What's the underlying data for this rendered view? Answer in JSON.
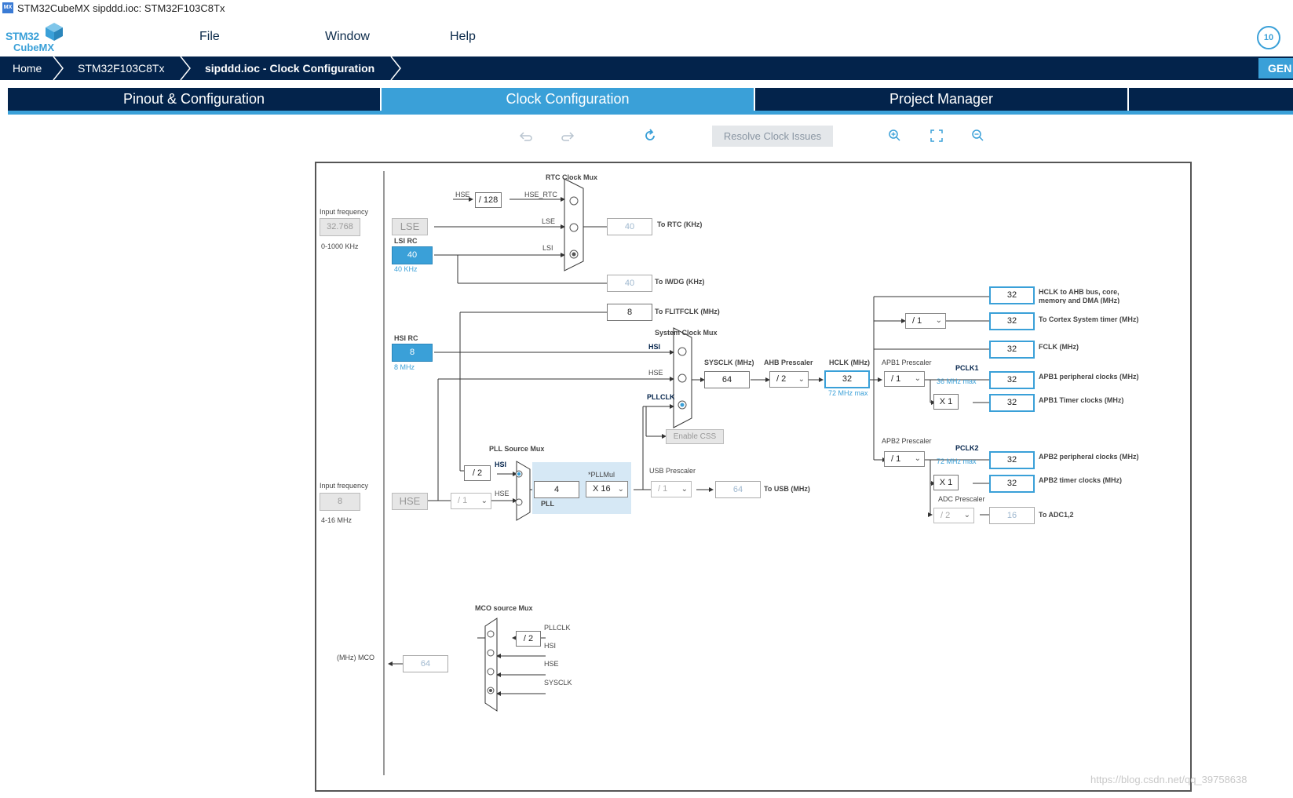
{
  "window": {
    "title": "STM32CubeMX sipddd.ioc: STM32F103C8Tx",
    "logo_text": "MX"
  },
  "brand": {
    "line1": "STM32",
    "line2": "CubeMX",
    "badge": "10"
  },
  "menu": {
    "file": "File",
    "window": "Window",
    "help": "Help"
  },
  "breadcrumb": {
    "home": "Home",
    "mcu": "STM32F103C8Tx",
    "page": "sipddd.ioc - Clock Configuration",
    "generate": "GEN"
  },
  "tabs": {
    "pinout": "Pinout & Configuration",
    "clock": "Clock Configuration",
    "project": "Project Manager"
  },
  "toolbar": {
    "resolve": "Resolve Clock Issues",
    "icons": [
      "undo-icon",
      "redo-icon",
      "refresh-icon",
      "zoom-in-icon",
      "fit-icon",
      "zoom-out-icon"
    ]
  },
  "colors": {
    "accent": "#3aa0d8",
    "navy": "#03234b"
  },
  "clock": {
    "lse_input_freq_label": "Input frequency",
    "lse_input_freq": "32.768",
    "lse_range": "0-1000 KHz",
    "lse": "LSE",
    "lsi_rc": "LSI RC",
    "lsi_value": "40",
    "lsi_khz": "40 KHz",
    "rtc_mux": "RTC Clock Mux",
    "hse_label": "HSE",
    "hse_div128": "/ 128",
    "hse_rtc": "HSE_RTC",
    "lse_line": "LSE",
    "lsi_line": "LSI",
    "to_rtc_value": "40",
    "to_rtc": "To RTC (KHz)",
    "to_iwdg_value": "40",
    "to_iwdg": "To IWDG (KHz)",
    "flitf_value": "8",
    "flitf": "To FLITFCLK (MHz)",
    "hsi_rc": "HSI RC",
    "hsi_value": "8",
    "hsi_mhz": "8 MHz",
    "sys_mux": "System Clock Mux",
    "hsi_line": "HSI",
    "hse_line": "HSE",
    "pllclk_line": "PLLCLK",
    "sysclk_label": "SYSCLK (MHz)",
    "sysclk": "64",
    "ahb_label": "AHB Prescaler",
    "ahb": "/ 2",
    "hclk_label": "HCLK (MHz)",
    "hclk": "32",
    "hclk_max": "72 MHz max",
    "enable_css": "Enable CSS",
    "pll_src_mux": "PLL Source Mux",
    "pll_div2": "/ 2",
    "pll_hsi": "HSI",
    "pll_hse": "HSE",
    "pll_in": "4",
    "pllmul_label": "*PLLMul",
    "pllmul": "X 16",
    "pll": "PLL",
    "usb_label": "USB Prescaler",
    "usb_presc": "/ 1",
    "usb_value": "64",
    "to_usb": "To USB (MHz)",
    "hse_input_label": "Input frequency",
    "hse_input": "8",
    "hse_range": "4-16 MHz",
    "hse": "HSE",
    "hse_presc": "/ 1",
    "mco_mux": "MCO source Mux",
    "mco_div2": "/ 2",
    "mco_pllclk": "PLLCLK",
    "mco_hsi": "HSI",
    "mco_hse": "HSE",
    "mco_sysclk": "SYSCLK",
    "mco_value": "64",
    "mco_label": "(MHz) MCO",
    "apb1_label": "APB1 Prescaler",
    "apb1": "/ 1",
    "pclk1": "PCLK1",
    "pclk1_max": "36 MHz max",
    "apb1_x1": "X 1",
    "apb2_label": "APB2 Prescaler",
    "apb2": "/ 1",
    "pclk2": "PCLK2",
    "pclk2_max": "72 MHz max",
    "apb2_x1": "X 1",
    "adc_label": "ADC Prescaler",
    "adc": "/ 2",
    "adc_value": "16",
    "to_adc": "To ADC1,2",
    "cortex_div": "/ 1",
    "outputs": [
      {
        "value": "32",
        "label": "HCLK to AHB bus, core, memory and DMA (MHz)"
      },
      {
        "value": "32",
        "label": "To Cortex System timer (MHz)"
      },
      {
        "value": "32",
        "label": "FCLK (MHz)"
      },
      {
        "value": "32",
        "label": "APB1 peripheral clocks (MHz)"
      },
      {
        "value": "32",
        "label": "APB1 Timer clocks (MHz)"
      },
      {
        "value": "32",
        "label": "APB2 peripheral clocks (MHz)"
      },
      {
        "value": "32",
        "label": "APB2 timer clocks (MHz)"
      }
    ]
  },
  "watermark": "https://blog.csdn.net/qq_39758638"
}
